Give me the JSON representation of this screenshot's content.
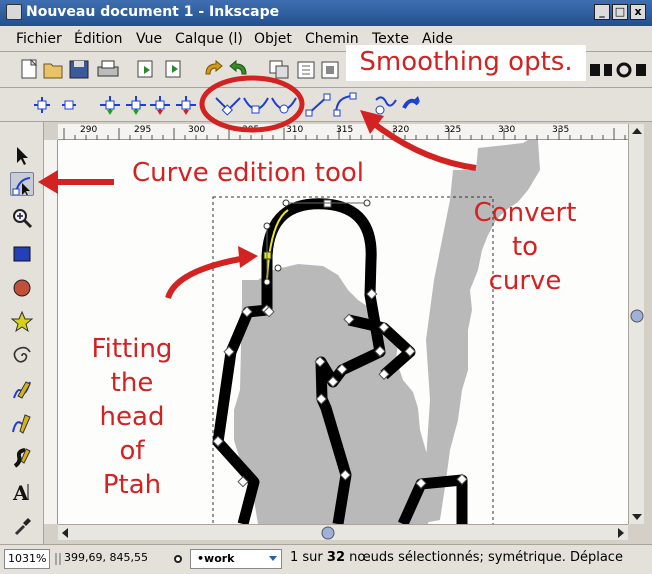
{
  "window": {
    "title": "Nouveau document 1 - Inkscape",
    "buttons": {
      "minimize": "_",
      "maximize": "□",
      "close": "x"
    }
  },
  "menubar": {
    "items": [
      "Fichier",
      "Édition",
      "Vue",
      "Calque (l)",
      "Objet",
      "Chemin",
      "Texte",
      "Aide"
    ]
  },
  "ruler": {
    "ticks": [
      "290",
      "295",
      "300",
      "305",
      "310",
      "315",
      "320",
      "325",
      "330",
      "335"
    ]
  },
  "statusbar": {
    "zoom": "1031%",
    "coords": "399,69, 845,55",
    "layer": "•work",
    "message_prefix": "1 sur ",
    "message_count": "32",
    "message_suffix": " nœuds sélectionnés; symétrique. Déplace"
  },
  "annotations": {
    "smoothing": "Smoothing opts.",
    "curve_tool": "Curve edition tool",
    "convert": [
      "Convert",
      "to",
      "curve"
    ],
    "fitting": [
      "Fitting",
      "the",
      "head",
      "of",
      "Ptah"
    ]
  },
  "colors": {
    "annotation": "#d32222",
    "titlebar": "#2d5c9e",
    "node_tool_blue": "#1f3fd0"
  }
}
